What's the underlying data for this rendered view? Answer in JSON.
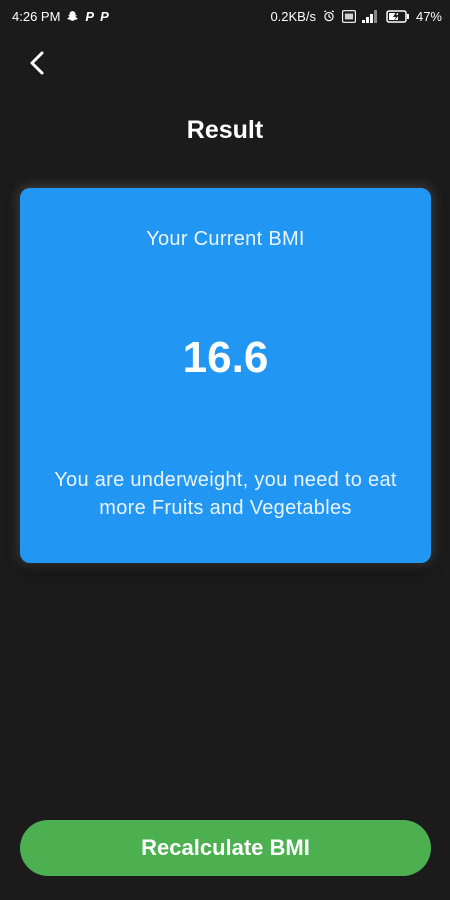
{
  "status_bar": {
    "time": "4:26 PM",
    "speed": "0.2KB/s",
    "battery_percent": "47%",
    "icons": [
      "snapchat-icon",
      "p-icon",
      "p-icon",
      "alarm-icon",
      "volte-icon",
      "signal-icon",
      "battery-icon"
    ],
    "p_letter": "P"
  },
  "header": {
    "back_icon": "chevron-left-icon",
    "title": "Result"
  },
  "result_card": {
    "label": "Your Current BMI",
    "bmi_value": "16.6",
    "message": "You are underweight, you need to eat more Fruits and Vegetables"
  },
  "actions": {
    "recalculate_label": "Recalculate BMI"
  },
  "colors": {
    "background": "#1b1b1b",
    "card": "#2196f3",
    "button": "#4caf50",
    "text": "#ffffff"
  }
}
